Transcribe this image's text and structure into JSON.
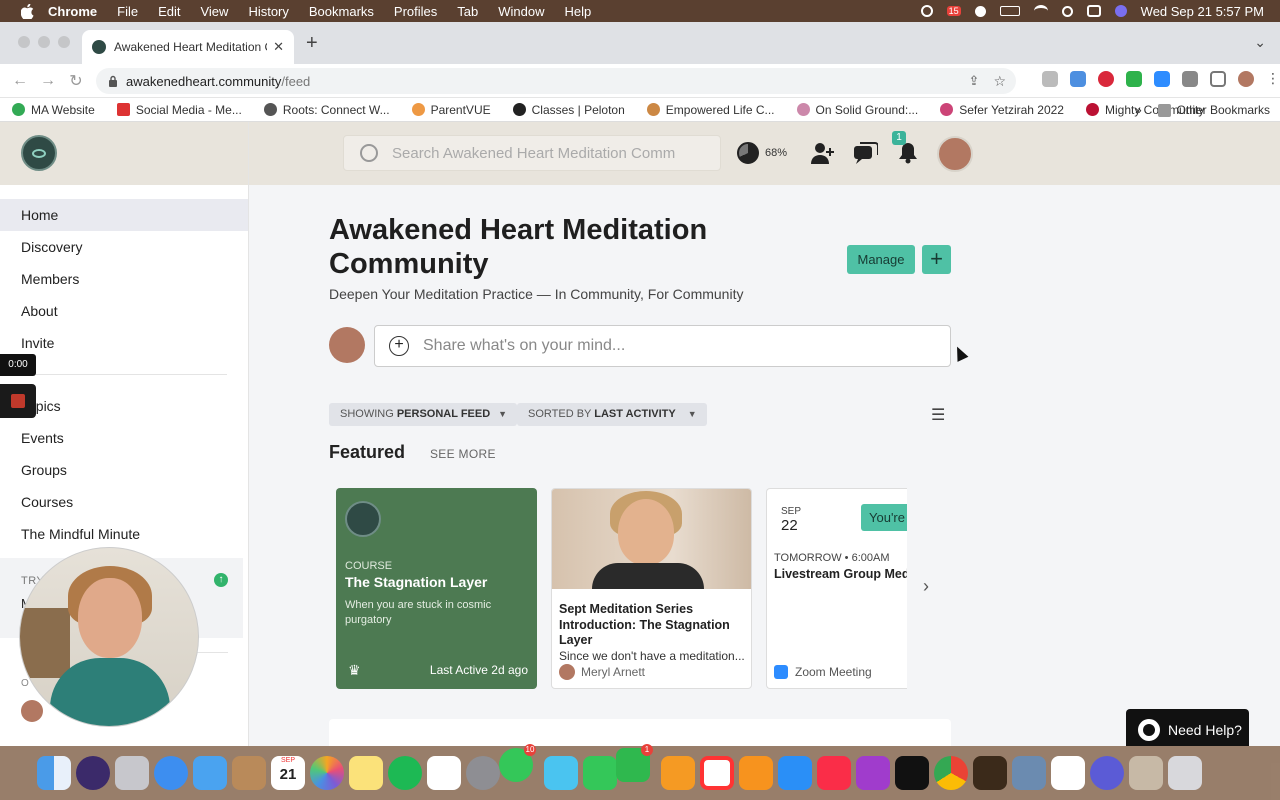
{
  "menubar": {
    "items": [
      "Chrome",
      "File",
      "Edit",
      "View",
      "History",
      "Bookmarks",
      "Profiles",
      "Tab",
      "Window",
      "Help"
    ],
    "clock": "Wed Sep 21  5:57 PM",
    "tray_badge": "15"
  },
  "browser": {
    "tab_title": "Awakened Heart Meditation Co",
    "url_host": "awakenedheart.community",
    "url_path": "/feed",
    "bookmarks": [
      "MA Website",
      "Social Media - Me...",
      "Roots: Connect W...",
      "ParentVUE",
      "Classes | Peloton",
      "Empowered Life C...",
      "On Solid Ground:...",
      "Sefer Yetzirah 2022",
      "Mighty Community"
    ],
    "bookmarks_overflow": "»",
    "other_bookmarks": "Other Bookmarks"
  },
  "sidebar": {
    "items": [
      "Home",
      "Discovery",
      "Members",
      "About",
      "Invite"
    ],
    "items2": [
      "Topics",
      "Events",
      "Groups",
      "Courses",
      "The Mindful Minute"
    ],
    "try_label": "TRY",
    "try_text": "M",
    "bottom_label": "O"
  },
  "header": {
    "search_placeholder": "Search Awakened Heart Meditation Comm",
    "progress_percent": "68%",
    "notifications_badge": "1"
  },
  "main": {
    "title": "Awakened Heart Meditation Community",
    "subtitle": "Deepen Your Meditation Practice — In Community, For Community",
    "manage_label": "Manage",
    "plus_label": "+",
    "composer_placeholder": "Share what's on your mind...",
    "filter1_prefix": "SHOWING",
    "filter1_value": "PERSONAL FEED",
    "filter2_prefix": "SORTED BY",
    "filter2_value": "LAST ACTIVITY",
    "featured_title": "Featured",
    "see_more": "SEE MORE"
  },
  "cards": {
    "c1": {
      "kind": "COURSE",
      "name": "The Stagnation Layer",
      "desc": "When you are stuck in cosmic purgatory",
      "activity": "Last Active 2d ago"
    },
    "c2": {
      "name": "Sept Meditation Series Introduction: The Stagnation Layer",
      "desc": "Since we don't have a meditation...",
      "author": "Meryl Arnett"
    },
    "c3": {
      "month": "SEP",
      "day": "22",
      "rsvp": "You're",
      "when": "TOMORROW • 6:00AM",
      "name": "Livestream Group Med",
      "platform": "Zoom Meeting"
    }
  },
  "help": {
    "label": "Need Help?"
  },
  "recording": {
    "timer": "0:00"
  },
  "dock": {
    "calendar_month": "SEP",
    "calendar_day": "21",
    "messages_badge": "10",
    "facetime_badge": "1"
  },
  "colors": {
    "accent": "#4fc1a5",
    "course_card": "#4d7a52",
    "header_bg": "#e8e4dc"
  }
}
